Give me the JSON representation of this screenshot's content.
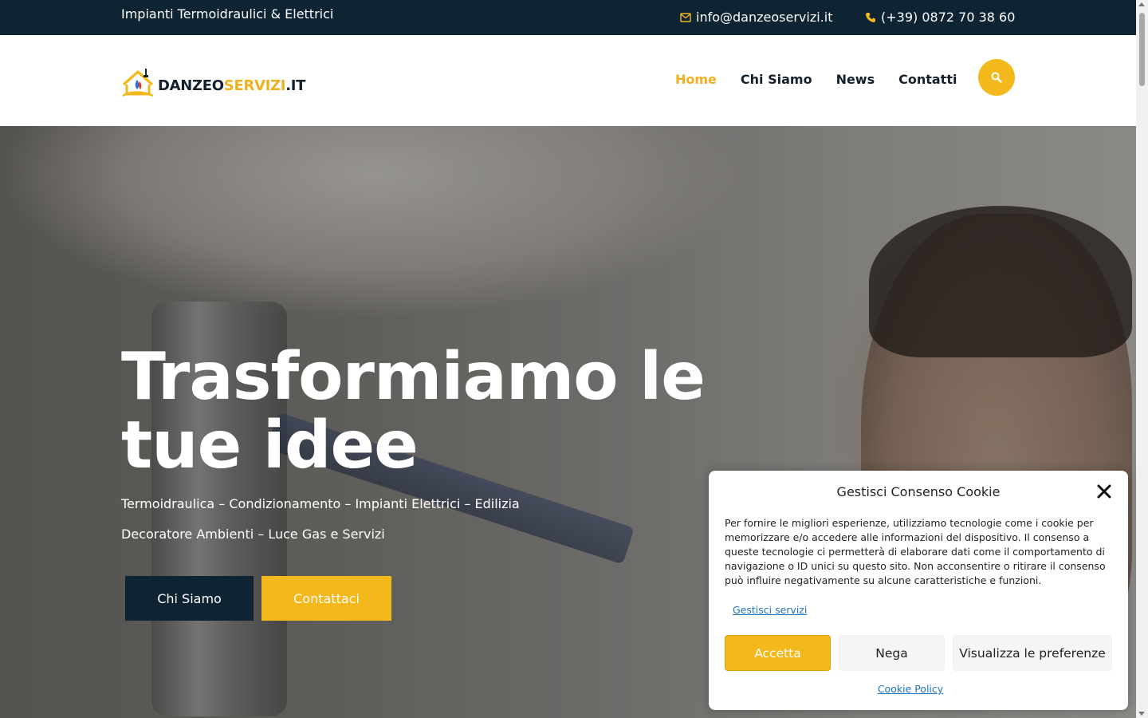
{
  "topbar": {
    "tagline": "Impianti Termoidraulici & Elettrici",
    "email": "info@danzeoservizi.it",
    "phone": "(+39) 0872 70 38 60"
  },
  "header": {
    "logo": {
      "part1": "DANZEO",
      "part2": "SERVIZI",
      "part3": ".IT"
    },
    "nav": [
      {
        "label": "Home",
        "active": true
      },
      {
        "label": "Chi Siamo",
        "active": false
      },
      {
        "label": "News",
        "active": false
      },
      {
        "label": "Contatti",
        "active": false
      }
    ],
    "search_icon": "search-icon"
  },
  "hero": {
    "title_line1": "Trasformiamo le",
    "title_line2": "tue idee",
    "subtitle_line1": "Termoidraulica – Condizionamento – Impianti Elettrici – Edilizia",
    "subtitle_line2": "Decoratore Ambienti – Luce Gas e Servizi",
    "buttons": {
      "primary": "Chi Siamo",
      "secondary": "Contattaci"
    }
  },
  "cookie": {
    "title": "Gestisci Consenso Cookie",
    "body": "Per fornire le migliori esperienze, utilizziamo tecnologie come i cookie per memorizzare e/o accedere alle informazioni del dispositivo. Il consenso a queste tecnologie ci permetterà di elaborare dati come il comportamento di navigazione o ID unici su questo sito. Non acconsentire o ritirare il consenso può influire negativamente su alcune caratteristiche e funzioni.",
    "manage_link": "Gestisci servizi",
    "accept": "Accetta",
    "deny": "Nega",
    "preferences": "Visualizza le preferenze",
    "policy_link": "Cookie Policy"
  },
  "colors": {
    "navy": "#0e2433",
    "gold": "#f2b81c"
  }
}
